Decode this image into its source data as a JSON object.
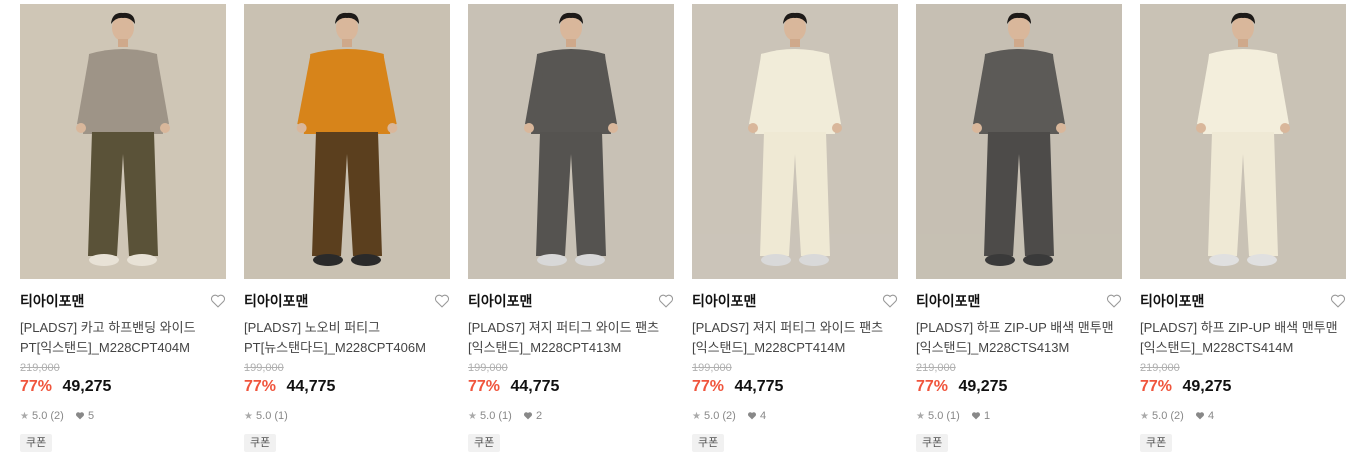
{
  "products": [
    {
      "brand": "티아이포맨",
      "name_line1": "[PLADS7] 카고 하프밴딩 와이드",
      "name_line2": "PT[익스탠드]_M228CPT404M",
      "original_price": "219,000",
      "discount": "77%",
      "price": "49,275",
      "rating": "5.0 (2)",
      "likes": "5",
      "coupon": "쿠폰",
      "colors": {
        "bg": "#cfc6b6",
        "top": "#9e9487",
        "bottom": "#5a5238",
        "shoe": "#e8e2d6"
      }
    },
    {
      "brand": "티아이포맨",
      "name_line1": "[PLADS7] 노오비 퍼티그",
      "name_line2": "PT[뉴스탠다드]_M228CPT406M",
      "original_price": "199,000",
      "discount": "77%",
      "price": "44,775",
      "rating": "5.0 (1)",
      "likes": "",
      "coupon": "쿠폰",
      "colors": {
        "bg": "#c9c1b2",
        "top": "#d7841a",
        "bottom": "#5b3f1e",
        "shoe": "#2a2a2a"
      }
    },
    {
      "brand": "티아이포맨",
      "name_line1": "[PLADS7] 져지 퍼티그 와이드 팬츠",
      "name_line2": "[익스탠드]_M228CPT413M",
      "original_price": "199,000",
      "discount": "77%",
      "price": "44,775",
      "rating": "5.0 (1)",
      "likes": "2",
      "coupon": "쿠폰",
      "colors": {
        "bg": "#c8c1b5",
        "top": "#585653",
        "bottom": "#555350",
        "shoe": "#d8d8d8"
      }
    },
    {
      "brand": "티아이포맨",
      "name_line1": "[PLADS7] 져지 퍼티그 와이드 팬츠",
      "name_line2": "[익스탠드]_M228CPT414M",
      "original_price": "199,000",
      "discount": "77%",
      "price": "44,775",
      "rating": "5.0 (2)",
      "likes": "4",
      "coupon": "쿠폰",
      "colors": {
        "bg": "#cbc4b8",
        "top": "#f1ecd9",
        "bottom": "#efe9d4",
        "shoe": "#d9d9d9"
      }
    },
    {
      "brand": "티아이포맨",
      "name_line1": "[PLADS7] 하프 ZIP-UP 배색 맨투맨",
      "name_line2": "[익스탠드]_M228CTS413M",
      "original_price": "219,000",
      "discount": "77%",
      "price": "49,275",
      "rating": "5.0 (1)",
      "likes": "1",
      "coupon": "쿠폰",
      "colors": {
        "bg": "#c6bfb3",
        "top": "#5c5a57",
        "bottom": "#4d4b49",
        "shoe": "#3a3a3a"
      }
    },
    {
      "brand": "티아이포맨",
      "name_line1": "[PLADS7] 하프 ZIP-UP 배색 맨투맨",
      "name_line2": "[익스탠드]_M228CTS414M",
      "original_price": "219,000",
      "discount": "77%",
      "price": "49,275",
      "rating": "5.0 (2)",
      "likes": "4",
      "coupon": "쿠폰",
      "colors": {
        "bg": "#c9c2b5",
        "top": "#f3eedc",
        "bottom": "#efe9d5",
        "shoe": "#e0e0e0"
      }
    }
  ]
}
